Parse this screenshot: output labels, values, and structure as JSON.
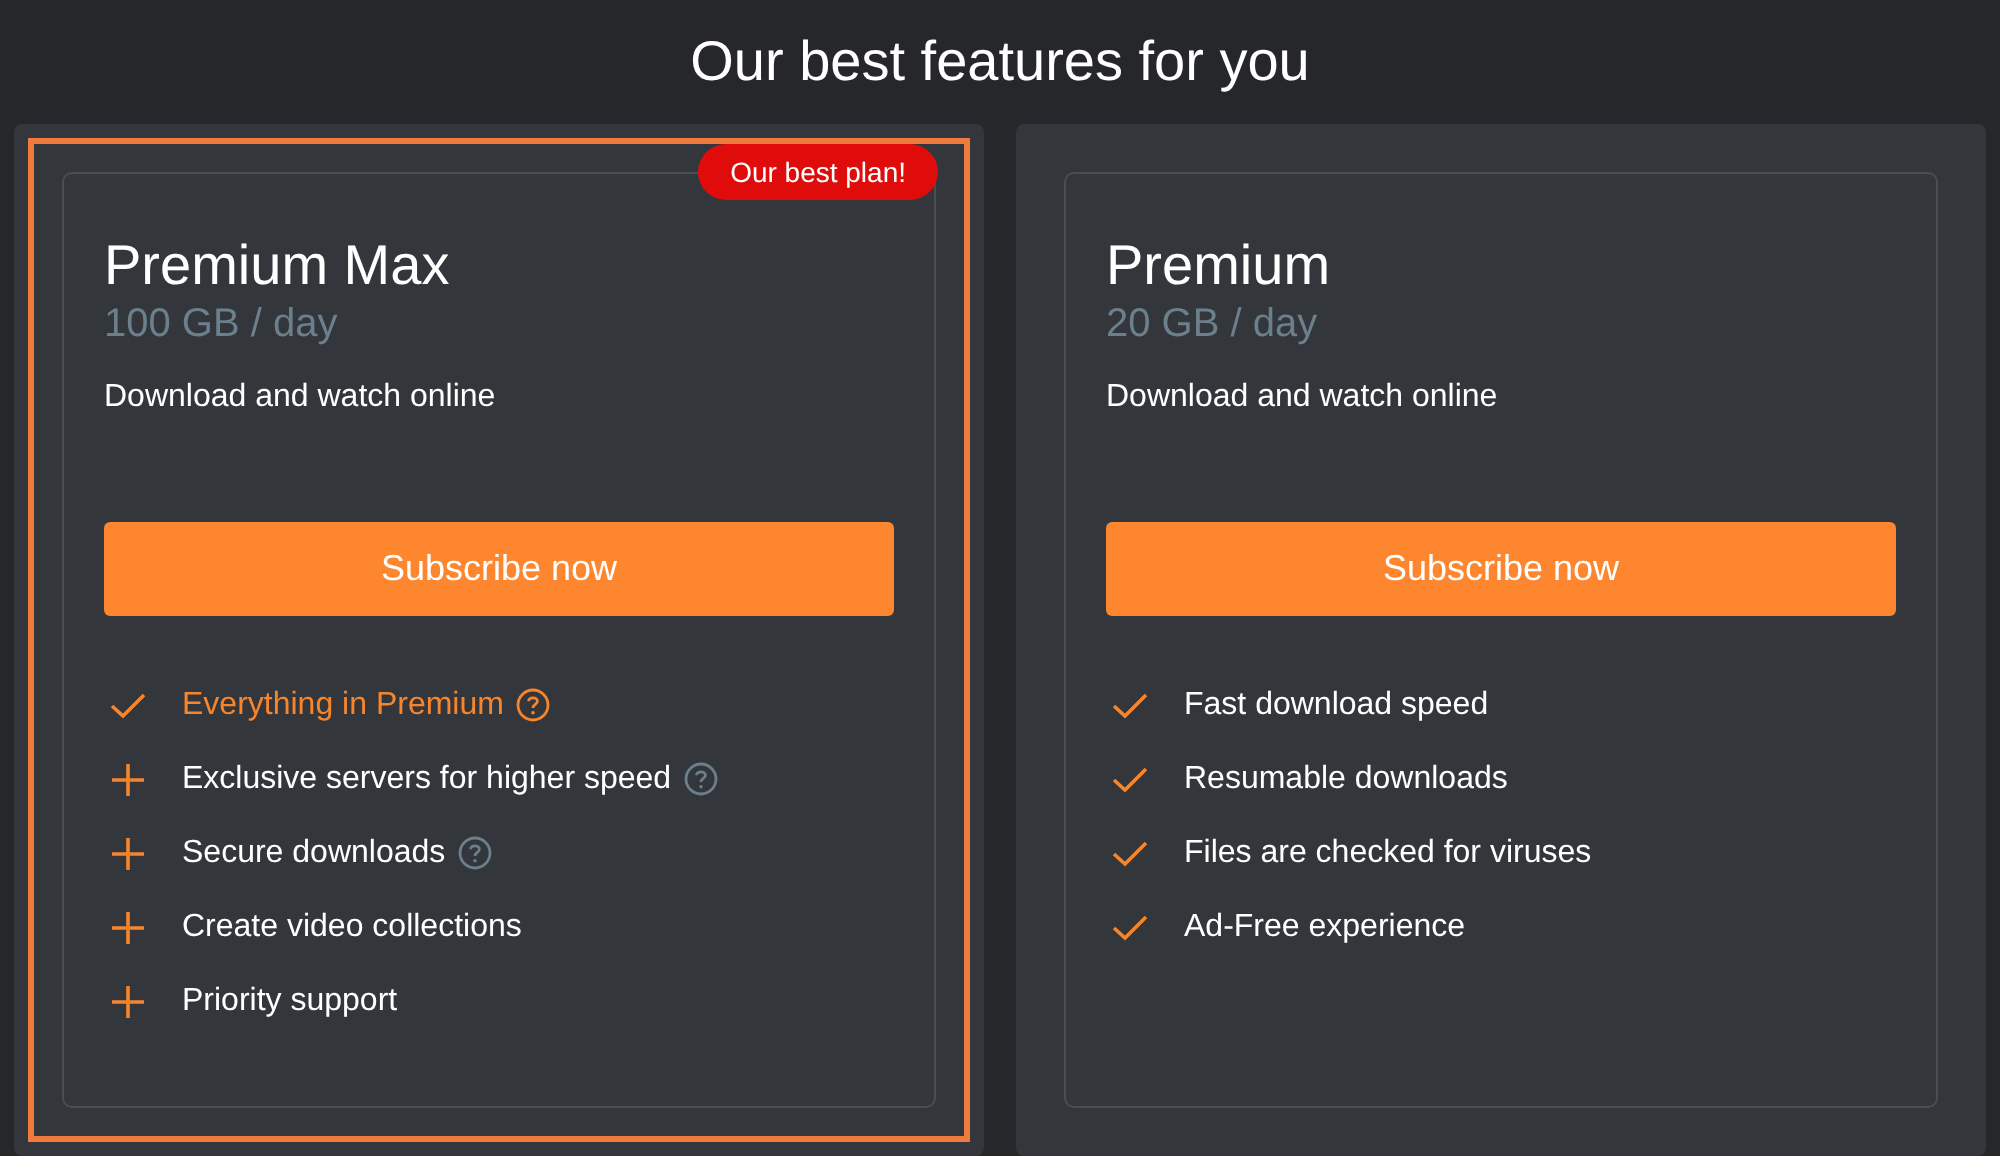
{
  "heading": "Our best features for you",
  "plans": [
    {
      "name": "Premium Max",
      "quota": "100 GB / day",
      "description": "Download and watch online",
      "badge": "Our best plan!",
      "highlighted": true,
      "button": "Subscribe now",
      "features": [
        {
          "kind": "check",
          "text": "Everything in Premium",
          "emphasized": true,
          "help": true
        },
        {
          "kind": "plus",
          "text": "Exclusive servers for higher speed",
          "emphasized": false,
          "help": true
        },
        {
          "kind": "plus",
          "text": "Secure downloads",
          "emphasized": false,
          "help": true
        },
        {
          "kind": "plus",
          "text": "Create video collections",
          "emphasized": false,
          "help": false
        },
        {
          "kind": "plus",
          "text": "Priority support",
          "emphasized": false,
          "help": false
        }
      ]
    },
    {
      "name": "Premium",
      "quota": "20 GB / day",
      "description": "Download and watch online",
      "highlighted": false,
      "button": "Subscribe now",
      "features": [
        {
          "kind": "check",
          "text": "Fast download speed",
          "emphasized": false,
          "help": false
        },
        {
          "kind": "check",
          "text": "Resumable downloads",
          "emphasized": false,
          "help": false
        },
        {
          "kind": "check",
          "text": "Files are checked for viruses",
          "emphasized": false,
          "help": false
        },
        {
          "kind": "check",
          "text": "Ad-Free experience",
          "emphasized": false,
          "help": false
        }
      ]
    }
  ]
}
